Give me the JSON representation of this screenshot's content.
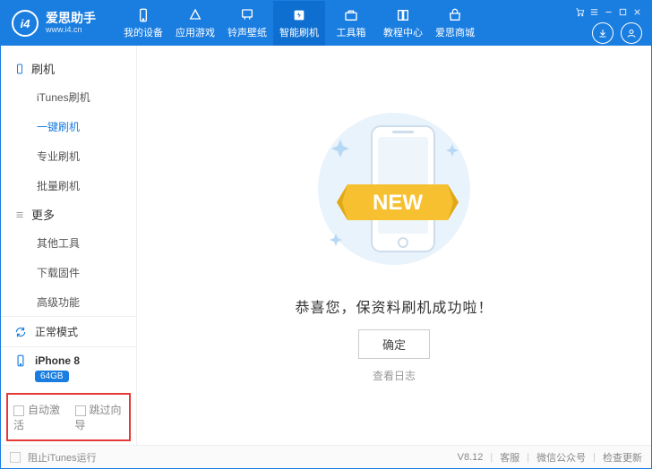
{
  "brand": {
    "cn": "爱思助手",
    "en": "www.i4.cn",
    "badge": "i4"
  },
  "nav": {
    "items": [
      {
        "label": "我的设备"
      },
      {
        "label": "应用游戏"
      },
      {
        "label": "铃声壁纸"
      },
      {
        "label": "智能刷机"
      },
      {
        "label": "工具箱"
      },
      {
        "label": "教程中心"
      },
      {
        "label": "爱思商城"
      }
    ]
  },
  "sidebar": {
    "group1_title": "刷机",
    "group1": [
      {
        "label": "iTunes刷机"
      },
      {
        "label": "一键刷机"
      },
      {
        "label": "专业刷机"
      },
      {
        "label": "批量刷机"
      }
    ],
    "group2_title": "更多",
    "group2": [
      {
        "label": "其他工具"
      },
      {
        "label": "下载固件"
      },
      {
        "label": "高级功能"
      }
    ],
    "status_mode": "正常模式",
    "device_name": "iPhone 8",
    "device_storage": "64GB",
    "bottom_opt1": "自动激活",
    "bottom_opt2": "跳过向导"
  },
  "main": {
    "success": "恭喜您，保资料刷机成功啦！",
    "ok": "确定",
    "log": "查看日志",
    "new": "NEW"
  },
  "footer": {
    "block_itunes": "阻止iTunes运行",
    "version": "V8.12",
    "support": "客服",
    "wechat": "微信公众号",
    "update": "检查更新"
  }
}
